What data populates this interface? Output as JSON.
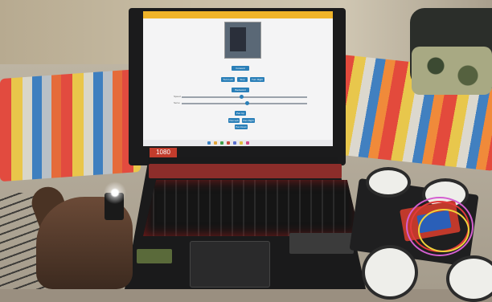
{
  "laptop": {
    "badge_text": "1080",
    "keyboard_sticker_text": "",
    "browser": {
      "buttons": {
        "forward": "Forward",
        "turn_left": "Turn Left",
        "stop": "Stop",
        "turn_right": "Turn Right",
        "backward": "Backward",
        "pan_up": "Pan Up",
        "pan_left": "Pan Left",
        "pan_right": "Pan Right",
        "pan_down": "Pan Down"
      },
      "sliders": [
        {
          "label": "Speed",
          "value": 0.48
        },
        {
          "label": "Servo",
          "value": 0.52
        }
      ]
    }
  },
  "colors": {
    "browser_tab_accent": "#f0b429",
    "button_blue": "#2a7fb8",
    "laptop_red": "#c23c2c"
  }
}
